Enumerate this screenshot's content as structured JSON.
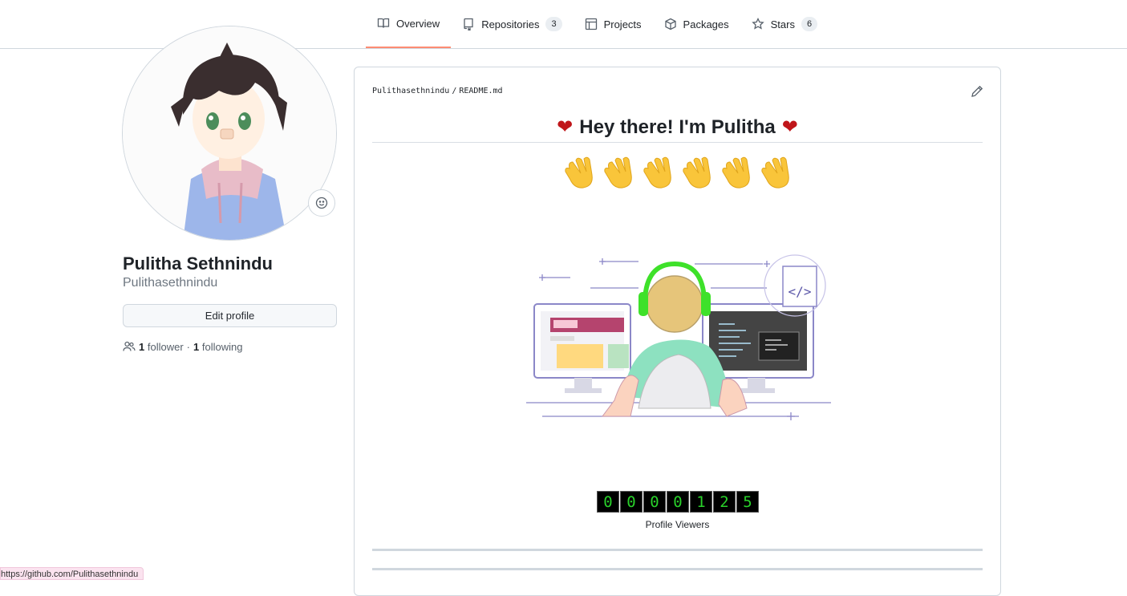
{
  "nav": {
    "tabs": [
      {
        "label": "Overview",
        "icon": "book-icon",
        "active": true
      },
      {
        "label": "Repositories",
        "icon": "repo-icon",
        "count": "3"
      },
      {
        "label": "Projects",
        "icon": "table-icon"
      },
      {
        "label": "Packages",
        "icon": "package-icon"
      },
      {
        "label": "Stars",
        "icon": "star-icon",
        "count": "6"
      }
    ]
  },
  "profile": {
    "fullname": "Pulitha Sethnindu",
    "username": "Pulithasethnindu",
    "edit_label": "Edit profile",
    "followers_count": "1",
    "followers_label": "follower",
    "separator": "·",
    "following_count": "1",
    "following_label": "following"
  },
  "readme": {
    "owner": "Pulithasethnindu",
    "slash": "/",
    "file": "README.md",
    "heart": "❤",
    "title": "Hey there! I'm Pulitha",
    "viewer_digits": [
      "0",
      "0",
      "0",
      "0",
      "1",
      "2",
      "5"
    ],
    "viewer_label": "Profile Viewers"
  },
  "status_bar": {
    "url": "https://github.com/Pulithasethnindu"
  },
  "colors": {
    "active_tab_underline": "#fd8c73",
    "heart": "#c0161a",
    "counter_digit": "#29d12a",
    "status_bg": "#fbe3ef"
  }
}
